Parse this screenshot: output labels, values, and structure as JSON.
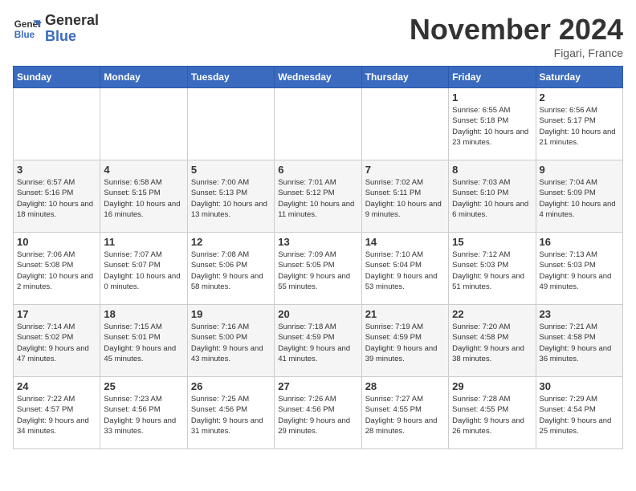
{
  "logo": {
    "line1": "General",
    "line2": "Blue"
  },
  "title": "November 2024",
  "location": "Figari, France",
  "days_header": [
    "Sunday",
    "Monday",
    "Tuesday",
    "Wednesday",
    "Thursday",
    "Friday",
    "Saturday"
  ],
  "weeks": [
    [
      {
        "day": "",
        "info": ""
      },
      {
        "day": "",
        "info": ""
      },
      {
        "day": "",
        "info": ""
      },
      {
        "day": "",
        "info": ""
      },
      {
        "day": "",
        "info": ""
      },
      {
        "day": "1",
        "info": "Sunrise: 6:55 AM\nSunset: 5:18 PM\nDaylight: 10 hours and 23 minutes."
      },
      {
        "day": "2",
        "info": "Sunrise: 6:56 AM\nSunset: 5:17 PM\nDaylight: 10 hours and 21 minutes."
      }
    ],
    [
      {
        "day": "3",
        "info": "Sunrise: 6:57 AM\nSunset: 5:16 PM\nDaylight: 10 hours and 18 minutes."
      },
      {
        "day": "4",
        "info": "Sunrise: 6:58 AM\nSunset: 5:15 PM\nDaylight: 10 hours and 16 minutes."
      },
      {
        "day": "5",
        "info": "Sunrise: 7:00 AM\nSunset: 5:13 PM\nDaylight: 10 hours and 13 minutes."
      },
      {
        "day": "6",
        "info": "Sunrise: 7:01 AM\nSunset: 5:12 PM\nDaylight: 10 hours and 11 minutes."
      },
      {
        "day": "7",
        "info": "Sunrise: 7:02 AM\nSunset: 5:11 PM\nDaylight: 10 hours and 9 minutes."
      },
      {
        "day": "8",
        "info": "Sunrise: 7:03 AM\nSunset: 5:10 PM\nDaylight: 10 hours and 6 minutes."
      },
      {
        "day": "9",
        "info": "Sunrise: 7:04 AM\nSunset: 5:09 PM\nDaylight: 10 hours and 4 minutes."
      }
    ],
    [
      {
        "day": "10",
        "info": "Sunrise: 7:06 AM\nSunset: 5:08 PM\nDaylight: 10 hours and 2 minutes."
      },
      {
        "day": "11",
        "info": "Sunrise: 7:07 AM\nSunset: 5:07 PM\nDaylight: 10 hours and 0 minutes."
      },
      {
        "day": "12",
        "info": "Sunrise: 7:08 AM\nSunset: 5:06 PM\nDaylight: 9 hours and 58 minutes."
      },
      {
        "day": "13",
        "info": "Sunrise: 7:09 AM\nSunset: 5:05 PM\nDaylight: 9 hours and 55 minutes."
      },
      {
        "day": "14",
        "info": "Sunrise: 7:10 AM\nSunset: 5:04 PM\nDaylight: 9 hours and 53 minutes."
      },
      {
        "day": "15",
        "info": "Sunrise: 7:12 AM\nSunset: 5:03 PM\nDaylight: 9 hours and 51 minutes."
      },
      {
        "day": "16",
        "info": "Sunrise: 7:13 AM\nSunset: 5:03 PM\nDaylight: 9 hours and 49 minutes."
      }
    ],
    [
      {
        "day": "17",
        "info": "Sunrise: 7:14 AM\nSunset: 5:02 PM\nDaylight: 9 hours and 47 minutes."
      },
      {
        "day": "18",
        "info": "Sunrise: 7:15 AM\nSunset: 5:01 PM\nDaylight: 9 hours and 45 minutes."
      },
      {
        "day": "19",
        "info": "Sunrise: 7:16 AM\nSunset: 5:00 PM\nDaylight: 9 hours and 43 minutes."
      },
      {
        "day": "20",
        "info": "Sunrise: 7:18 AM\nSunset: 4:59 PM\nDaylight: 9 hours and 41 minutes."
      },
      {
        "day": "21",
        "info": "Sunrise: 7:19 AM\nSunset: 4:59 PM\nDaylight: 9 hours and 39 minutes."
      },
      {
        "day": "22",
        "info": "Sunrise: 7:20 AM\nSunset: 4:58 PM\nDaylight: 9 hours and 38 minutes."
      },
      {
        "day": "23",
        "info": "Sunrise: 7:21 AM\nSunset: 4:58 PM\nDaylight: 9 hours and 36 minutes."
      }
    ],
    [
      {
        "day": "24",
        "info": "Sunrise: 7:22 AM\nSunset: 4:57 PM\nDaylight: 9 hours and 34 minutes."
      },
      {
        "day": "25",
        "info": "Sunrise: 7:23 AM\nSunset: 4:56 PM\nDaylight: 9 hours and 33 minutes."
      },
      {
        "day": "26",
        "info": "Sunrise: 7:25 AM\nSunset: 4:56 PM\nDaylight: 9 hours and 31 minutes."
      },
      {
        "day": "27",
        "info": "Sunrise: 7:26 AM\nSunset: 4:56 PM\nDaylight: 9 hours and 29 minutes."
      },
      {
        "day": "28",
        "info": "Sunrise: 7:27 AM\nSunset: 4:55 PM\nDaylight: 9 hours and 28 minutes."
      },
      {
        "day": "29",
        "info": "Sunrise: 7:28 AM\nSunset: 4:55 PM\nDaylight: 9 hours and 26 minutes."
      },
      {
        "day": "30",
        "info": "Sunrise: 7:29 AM\nSunset: 4:54 PM\nDaylight: 9 hours and 25 minutes."
      }
    ]
  ]
}
